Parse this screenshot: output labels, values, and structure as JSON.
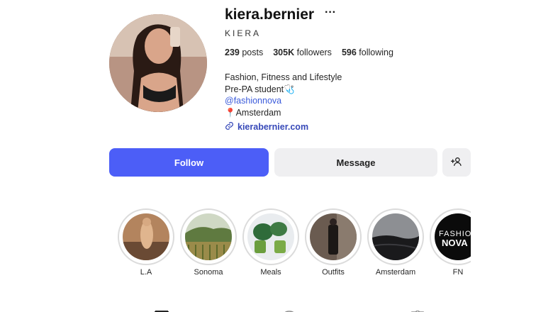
{
  "profile": {
    "username": "kiera.bernier",
    "more_glyph": "···",
    "full_name": "KIERA",
    "stats": {
      "posts_count": "239",
      "posts_label": "posts",
      "followers_count": "305K",
      "followers_label": "followers",
      "following_count": "596",
      "following_label": "following"
    },
    "bio_lines": [
      "Fashion, Fitness and Lifestyle",
      "Pre-PA student🩺",
      "@fashionnova",
      "📍Amsterdam"
    ],
    "website": "kierabernier.com"
  },
  "actions": {
    "follow_label": "Follow",
    "message_label": "Message"
  },
  "highlights": [
    {
      "label": "L.A"
    },
    {
      "label": "Sonoma"
    },
    {
      "label": "Meals"
    },
    {
      "label": "Outfits"
    },
    {
      "label": "Amsterdam"
    },
    {
      "label": "FN",
      "image_text": "FASHION NOVA"
    }
  ],
  "tabs": [
    {
      "icon": "grid-icon"
    },
    {
      "icon": "reels-icon"
    },
    {
      "icon": "tagged-icon"
    }
  ],
  "colors": {
    "accent": "#4c5ef7",
    "link": "#3648b8",
    "mention": "#3b5bdb",
    "secondary_button": "#efeff1"
  }
}
